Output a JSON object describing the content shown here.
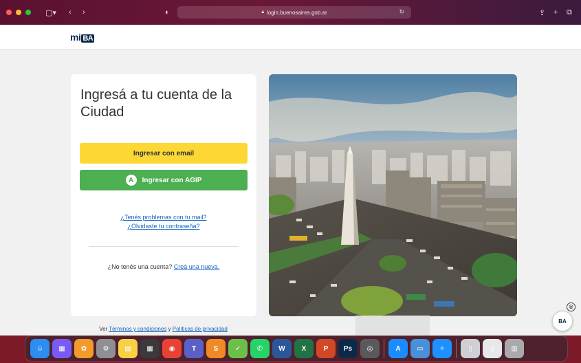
{
  "browser": {
    "url": "login.buenosaires.gob.ar"
  },
  "site": {
    "logo_prefix": "mi",
    "logo_suffix": "BA"
  },
  "login_card": {
    "title": "Ingresá a tu cuenta de la Ciudad",
    "email_button": "Ingresar con email",
    "agip_button": "Ingresar con AGIP",
    "agip_icon_letter": "A",
    "mail_problem_link": "¿Tenés problemas con tu mail?",
    "forgot_password_link": "¿Olvidaste tu contraseña?",
    "no_account_text": "¿No tenés una cuenta?",
    "create_account_link": "Creá una nueva."
  },
  "footer": {
    "prefix": "Ver",
    "terms_link": "Términos y condiciones",
    "connector": "y",
    "privacy_link": "Políticas de privacidad"
  },
  "chat_widget": {
    "label": "BA",
    "close_glyph": "⊗"
  },
  "colors": {
    "email_button": "#fdd835",
    "agip_button": "#4caf50",
    "link": "#1565c0",
    "brand_navy": "#0b2a4a"
  },
  "dock": {
    "apps": [
      {
        "name": "finder-icon",
        "glyph": "☺",
        "color": "#2b8ef0"
      },
      {
        "name": "launchpad-icon",
        "glyph": "▦",
        "color": "#7a5af5"
      },
      {
        "name": "photos-icon",
        "glyph": "✿",
        "color": "#f29b2b"
      },
      {
        "name": "system-settings-icon",
        "glyph": "⚙",
        "color": "#8e8e93"
      },
      {
        "name": "notes-icon",
        "glyph": "▤",
        "color": "#f7d046"
      },
      {
        "name": "calculator-icon",
        "glyph": "▦",
        "color": "#3a3a3c"
      },
      {
        "name": "chrome-icon",
        "glyph": "◉",
        "color": "#e94235"
      },
      {
        "name": "teams-icon",
        "glyph": "T",
        "color": "#5b5fc7"
      },
      {
        "name": "sublime-icon",
        "glyph": "S",
        "color": "#f08a24"
      },
      {
        "name": "checklist-icon",
        "glyph": "✓",
        "color": "#6cc04a"
      },
      {
        "name": "whatsapp-icon",
        "glyph": "✆",
        "color": "#25d366"
      },
      {
        "name": "word-icon",
        "glyph": "W",
        "color": "#2b579a"
      },
      {
        "name": "excel-icon",
        "glyph": "X",
        "color": "#217346"
      },
      {
        "name": "powerpoint-icon",
        "glyph": "P",
        "color": "#d24726"
      },
      {
        "name": "photoshop-icon",
        "glyph": "Ps",
        "color": "#0b2a48"
      },
      {
        "name": "screenshot-icon",
        "glyph": "◎",
        "color": "#5a5a5e"
      },
      {
        "name": "app-store-icon",
        "glyph": "A",
        "color": "#1a8cff"
      },
      {
        "name": "preview-icon",
        "glyph": "▭",
        "color": "#4a90d9"
      },
      {
        "name": "safari-icon",
        "glyph": "✧",
        "color": "#1e90ff"
      },
      {
        "name": "documents-icon",
        "glyph": "▯",
        "color": "#cfcfd4"
      },
      {
        "name": "file-icon",
        "glyph": "▯",
        "color": "#e8e8ec"
      },
      {
        "name": "trash-icon",
        "glyph": "▥",
        "color": "#a9a9ae"
      }
    ]
  }
}
